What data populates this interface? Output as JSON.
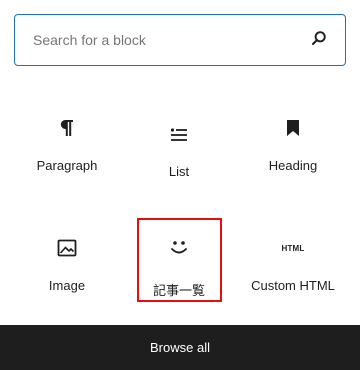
{
  "search": {
    "placeholder": "Search for a block",
    "value": "",
    "icon": "search-icon"
  },
  "blocks": [
    {
      "label": "Paragraph",
      "icon": "paragraph-icon"
    },
    {
      "label": "List",
      "icon": "list-icon"
    },
    {
      "label": "Heading",
      "icon": "bookmark-icon"
    },
    {
      "label": "Image",
      "icon": "image-icon"
    },
    {
      "label": "記事一覧",
      "icon": "smiley-icon"
    },
    {
      "label": "Custom HTML",
      "icon": "html-icon",
      "icon_text": "HTML"
    }
  ],
  "footer": {
    "browse_label": "Browse all"
  },
  "colors": {
    "accent": "#2271b1",
    "highlight": "#e01010",
    "footer_bg": "#1e1e1e",
    "text": "#1e1e1e"
  }
}
